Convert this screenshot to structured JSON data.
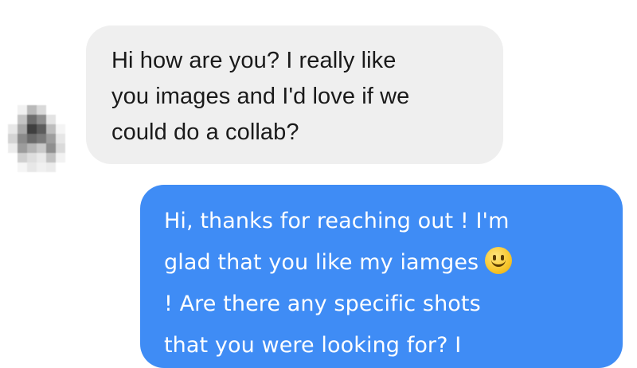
{
  "thread": {
    "incoming": {
      "lines": [
        "Hi how are you? I really like",
        "you images and I'd love if we",
        "could do a collab?"
      ]
    },
    "outgoing": {
      "lines": [
        "Hi, thanks for reaching out ! I'm",
        "glad that you like my iamges",
        "! Are there any specific shots",
        "that you were looking for? I"
      ]
    },
    "emoji_icon": "slightly-smiling-face-icon"
  }
}
